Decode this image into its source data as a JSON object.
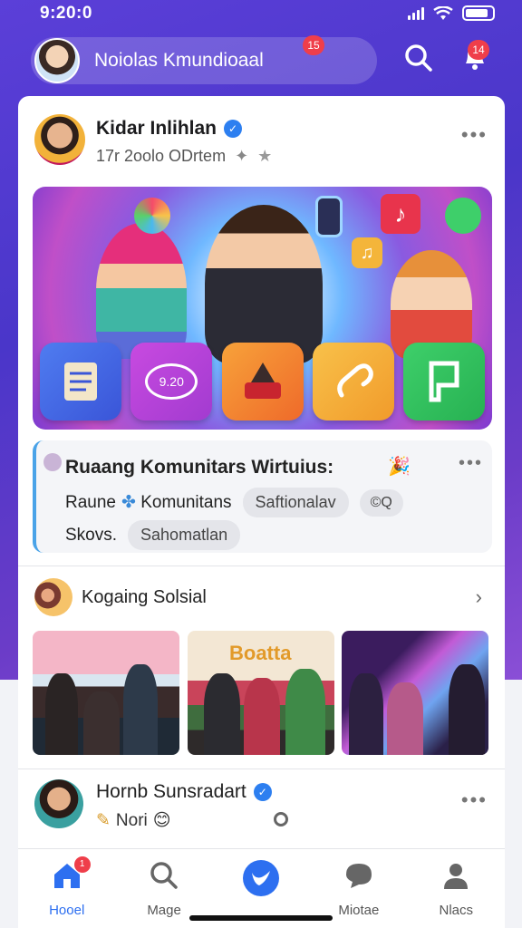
{
  "status_bar": {
    "time": "9:20:0"
  },
  "header": {
    "title": "Noiolas Kmundioaal",
    "badge": "15",
    "notif_badge": "14"
  },
  "post": {
    "author": "Kidar Inlihlan",
    "meta": "17r 2oolo   ODrtem",
    "hero_tiles": [
      "notes",
      "chat",
      "shop",
      "music",
      "flag"
    ],
    "chat_tile_text": "9.20"
  },
  "community": {
    "title": "Ruaang Komunitars Wirtuius:",
    "row1_text_a": "Raune",
    "row1_text_b": "Komunitans",
    "row1_chip": "Saftionalav",
    "row1_chip_icon": "©Q",
    "row2_text": "Skovs.",
    "row2_chip": "Sahomatlan"
  },
  "group": {
    "title": "Kogaing Solsial",
    "photo_banner": "Boatta"
  },
  "post2": {
    "author": "Hornb Sunsradart",
    "sub": "Nori"
  },
  "tabs": [
    {
      "label": "Hooel",
      "badge": "1",
      "icon": "home-icon"
    },
    {
      "label": "Mage",
      "icon": "search-icon"
    },
    {
      "label": "",
      "icon": "bird-icon"
    },
    {
      "label": "Miotae",
      "icon": "chat-bubble-icon"
    },
    {
      "label": "Nlacs",
      "icon": "profile-icon"
    }
  ],
  "colors": {
    "accent": "#2d6ff0",
    "badge": "#ef3e4a",
    "header_bg": "#5b3fd8"
  }
}
